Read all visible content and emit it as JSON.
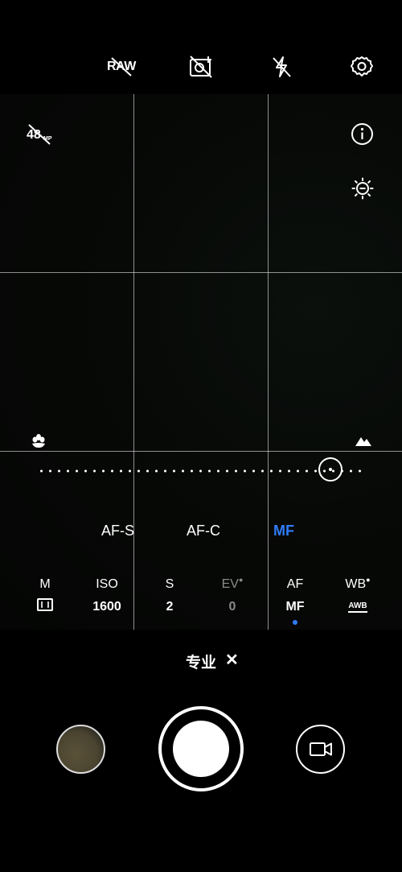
{
  "top_bar": {
    "raw_label": "RAW",
    "icons": [
      "raw-off-icon",
      "live-photo-off-icon",
      "flash-off-icon",
      "settings-gear-icon"
    ]
  },
  "overlay": {
    "megapixel_label": "48",
    "megapixel_unit": "MP",
    "info_icon": "info-icon",
    "exposure_icon": "sun-minus-icon",
    "macro_icon": "flower-icon",
    "landscape_icon": "mountain-icon"
  },
  "focus": {
    "level": 0.89
  },
  "focus_modes": {
    "af_s": "AF-S",
    "af_c": "AF-C",
    "mf": "MF",
    "active_color": "#2f7cf6"
  },
  "params": {
    "m": {
      "label": "M",
      "value_icon": "metering-icon"
    },
    "iso": {
      "label": "ISO",
      "value": "1600"
    },
    "s": {
      "label": "S",
      "value": "2"
    },
    "ev": {
      "label": "EV",
      "value": "0"
    },
    "af": {
      "label": "AF",
      "value": "MF"
    },
    "wb": {
      "label": "WB",
      "value": "AWB"
    }
  },
  "mode": {
    "label": "专业",
    "close": "✕"
  },
  "bottom": {
    "gallery_icon": "gallery-thumbnail",
    "video_icon": "video-camera-icon"
  }
}
